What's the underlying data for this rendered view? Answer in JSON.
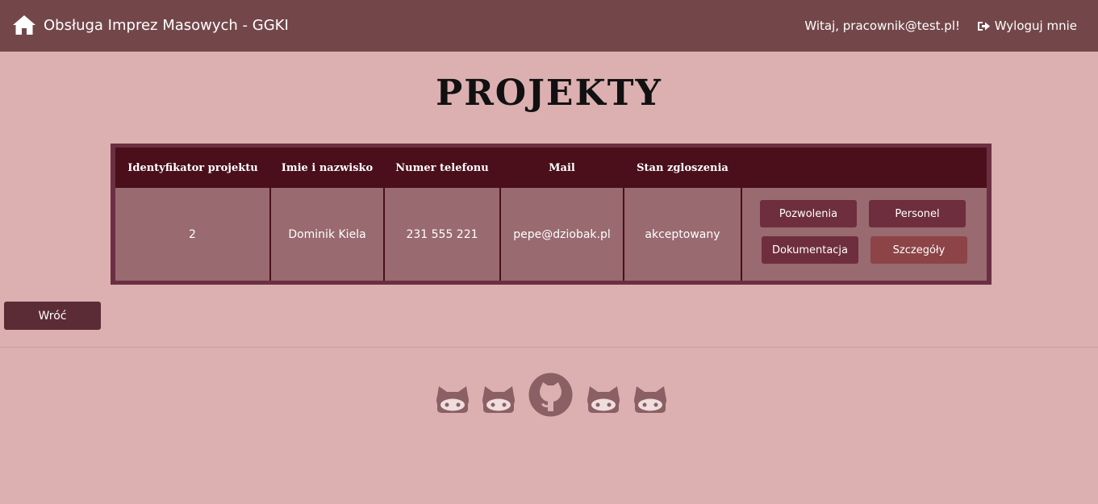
{
  "header": {
    "brand": "Obsługa Imprez Masowych - GGKI",
    "greeting": "Witaj, pracownik@test.pl!",
    "logout_label": "Wyloguj mnie"
  },
  "page": {
    "title": "PROJEKTY"
  },
  "table": {
    "columns": [
      "Identyfikator projektu",
      "Imie i nazwisko",
      "Numer telefonu",
      "Mail",
      "Stan zgloszenia",
      ""
    ],
    "rows": [
      {
        "id": "2",
        "name": "Dominik Kiela",
        "phone": "231 555 221",
        "mail": "pepe@dziobak.pl",
        "status": "akceptowany",
        "actions": {
          "permits": "Pozwolenia",
          "staff": "Personel",
          "docs": "Dokumentacja",
          "details": "Szczegóły"
        }
      }
    ]
  },
  "back_label": "Wróć",
  "colors": {
    "navbar": "#73474a",
    "background": "#dcafb0",
    "table_header": "#4a0f1b",
    "table_cell": "#996a70",
    "button": "#6e2e3e",
    "details_button": "#8c4446"
  },
  "footer": {
    "icons": [
      "octocat-icon",
      "octocat-icon",
      "github-icon",
      "octocat-icon",
      "octocat-icon"
    ]
  }
}
